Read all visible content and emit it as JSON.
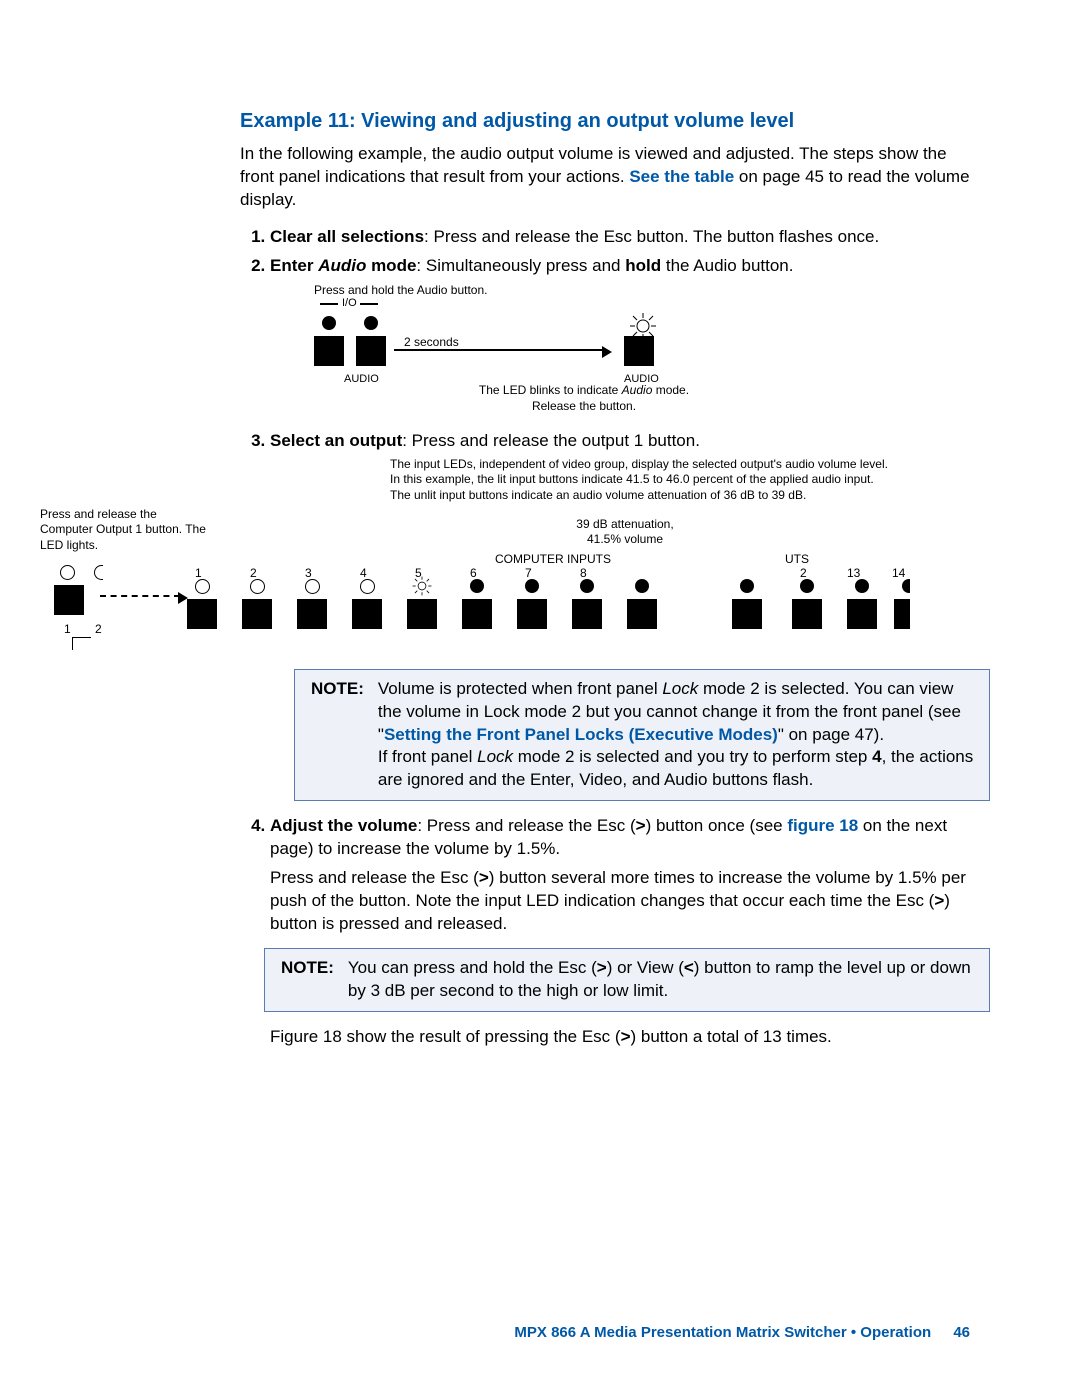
{
  "title": "Example 11: Viewing and adjusting an output volume level",
  "intro_a": "In the following example, the audio output volume is viewed and adjusted. The steps show the front panel indications that result from your actions. ",
  "intro_link": "See the table",
  "intro_b": " on page 45 to read the volume display.",
  "step1_bold": "Clear all selections",
  "step1_rest": ": Press and release the Esc button. The button flashes once.",
  "step2_bold_a": "Enter ",
  "step2_bi": "Audio",
  "step2_bold_b": " mode",
  "step2_rest_a": ": Simultaneously press and ",
  "step2_hold": "hold",
  "step2_rest_b": " the Audio button.",
  "d1": {
    "press": "Press and hold the Audio button.",
    "io": "I/O",
    "two_sec": "2 seconds",
    "audio1": "AUDIO",
    "audio2": "AUDIO",
    "blink_a": "The LED blinks to indicate ",
    "blink_i": "Audio",
    "blink_b": " mode.",
    "release": "Release the button."
  },
  "step3_bold": "Select an output",
  "step3_rest": ": Press and release the output 1 button.",
  "d2": {
    "top1": "The input LEDs, independent of video group, display the selected output's audio volume level.",
    "top2": "In this example, the lit input buttons indicate 41.5 to 46.0 percent of the applied audio input.",
    "top3": "The unlit input buttons indicate an audio volume attenuation   of 36 dB to 39 dB.",
    "press1": "Press and release the Computer Output 1 button. The LED lights.",
    "db": "39 dB attenuation, 41.5% volume",
    "compin": "COMPUTER INPUTS",
    "uts": "UTS",
    "nums": [
      "1",
      "2",
      "3",
      "4",
      "5",
      "6",
      "7",
      "8",
      "2",
      "13",
      "14"
    ],
    "out1": "1",
    "out2": "2"
  },
  "note1": {
    "label": "NOTE:",
    "a": "Volume is protected when front panel ",
    "lock_i": "Lock",
    "b": " mode 2 is selected.  You can view the volume in Lock mode 2 but you cannot change it from the front panel (see \"",
    "link": "Setting the Front Panel Locks (Executive Modes)",
    "c": "\" on page 47).",
    "d": "If front panel ",
    "e": " mode 2 is selected and you try to perform step ",
    "four": "4",
    "f": ", the actions are ignored and the Enter, Video, and Audio buttons flash."
  },
  "step4_bold": "Adjust the volume",
  "step4_a": ": Press and release the Esc (",
  "gt": ">",
  "lt": "<",
  "step4_b": ") button once (see ",
  "step4_link": "figure 18",
  "step4_c": " on the next page) to increase the volume by 1.5%.",
  "step4_p2_a": "Press and release the Esc (",
  "step4_p2_b": ") button several more times to increase the volume by 1.5% per push of the button. Note the input LED indication changes that occur each time the Esc (",
  "step4_p2_c": ") button is pressed and released.",
  "note2": {
    "label": "NOTE:",
    "a": "You can press and hold the Esc (",
    "b": ") or View (",
    "c": ") button to ramp the level up or down by 3 dB per second to the high or low limit."
  },
  "figtext_a": "Figure 18 show the result of pressing the Esc (",
  "figtext_b": ") button a total of 13 times.",
  "footer": {
    "text": "MPX 866 A Media Presentation Matrix Switcher • Operation",
    "page": "46"
  }
}
